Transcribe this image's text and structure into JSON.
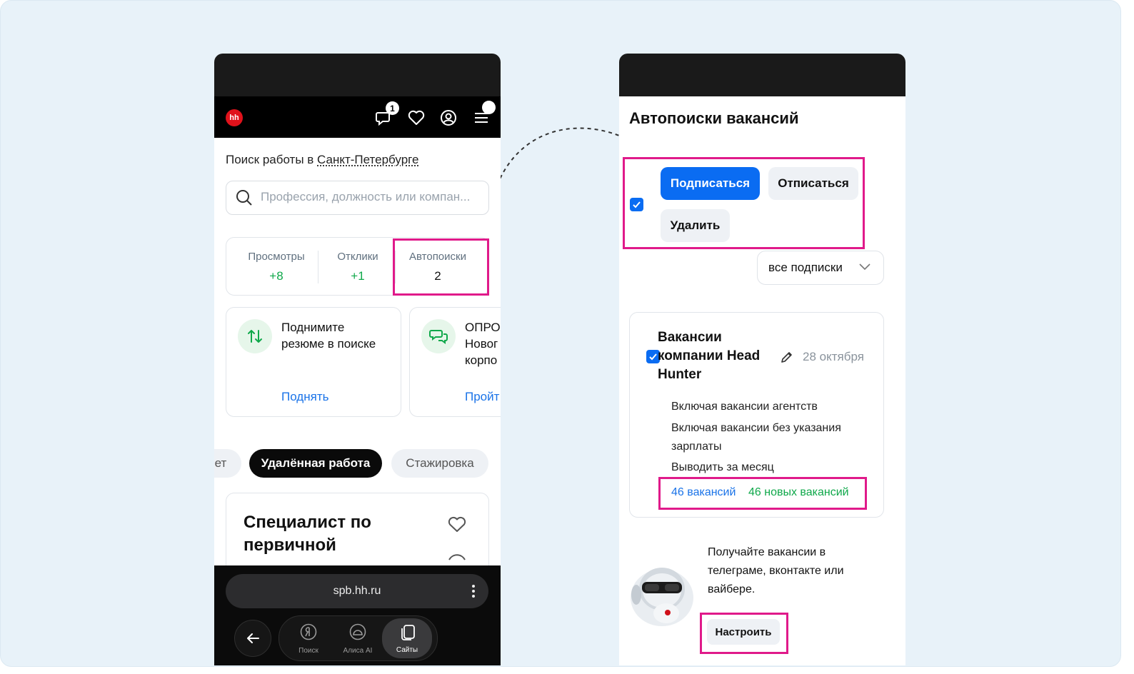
{
  "left_screen": {
    "badge_count": "1",
    "location_prefix": "Поиск работы в ",
    "location_city": "Санкт-Петербурге",
    "search_placeholder": "Профессия, должность или компан...",
    "stats": [
      {
        "label": "Просмотры",
        "value": "+8"
      },
      {
        "label": "Отклики",
        "value": "+1"
      },
      {
        "label": "Автопоиски",
        "value": "2"
      }
    ],
    "card1": {
      "text_line1": "Поднимите",
      "text_line2": "резюме в поиске",
      "link": "Поднять"
    },
    "card2": {
      "text_line1": "ОПРО",
      "text_line2": "Новог",
      "text_line3": "корпо",
      "link": "Пройт"
    },
    "chips": [
      "ет",
      "Удалённая работа",
      "Стажировка"
    ],
    "vacancy_title_line1": "Специалист по",
    "vacancy_title_line2": "первичной",
    "url": "spb.hh.ru",
    "bottom_tabs": [
      "Поиск",
      "Алиса AI",
      "Сайты"
    ]
  },
  "right_screen": {
    "title": "Автопоиски вакансий",
    "subscribe_button": "Подписаться",
    "unsubscribe_button": "Отписаться",
    "delete_button": "Удалить",
    "filter_select": "все подписки",
    "subscription": {
      "title": "Вакансии компании Head Hunter",
      "date": "28 октября",
      "details": [
        "Включая вакансии агентств",
        "Включая вакансии без указания зарплаты",
        "Выводить за месяц"
      ],
      "vacancies_link": "46 вакансий",
      "new_vacancies_link": "46 новых вакансий"
    },
    "promo_text": "Получайте вакансии в телеграме, вконтакте или вайбере.",
    "setup_button": "Настроить"
  },
  "colors": {
    "highlight": "#e01a8a",
    "primary_blue": "#0a6cf2",
    "link_blue": "#1a73e8",
    "green": "#0fa84a",
    "hh_red": "#e0121b"
  }
}
